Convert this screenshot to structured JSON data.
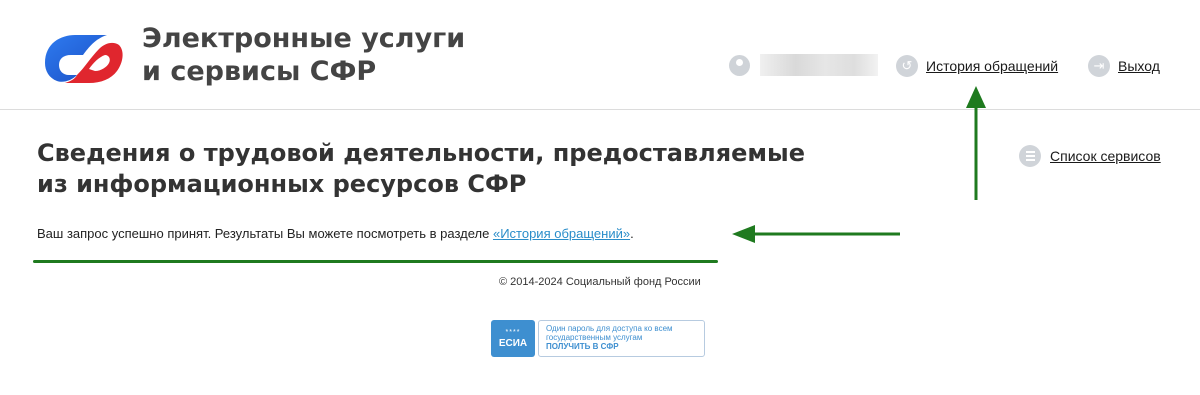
{
  "header": {
    "brand_line1": "Электронные услуги",
    "brand_line2": "и сервисы СФР",
    "history_link": "История обращений",
    "logout_link": "Выход"
  },
  "page": {
    "title": "Сведения о трудовой деятельности, предоставляемые из информационных ресурсов СФР",
    "services_link": "Список сервисов",
    "message_prefix": "Ваш запрос успешно принят. Результаты Вы можете посмотреть в разделе ",
    "message_link": "«История обращений»",
    "message_suffix": "."
  },
  "footer": {
    "copyright": "© 2014-2024 Социальный фонд России",
    "esia_badge": "ЕСИА",
    "esia_stars": "****",
    "esia_text1": "Один пароль для доступа ко всем",
    "esia_text2": "государственным услугам",
    "esia_text3": "ПОЛУЧИТЬ В СФР"
  },
  "colors": {
    "logo_blue": "#1f63d8",
    "logo_red": "#e0262e",
    "link_blue": "#2a8dc9",
    "annotation_green": "#1f7a1f",
    "esia_blue": "#3e8fd0"
  }
}
